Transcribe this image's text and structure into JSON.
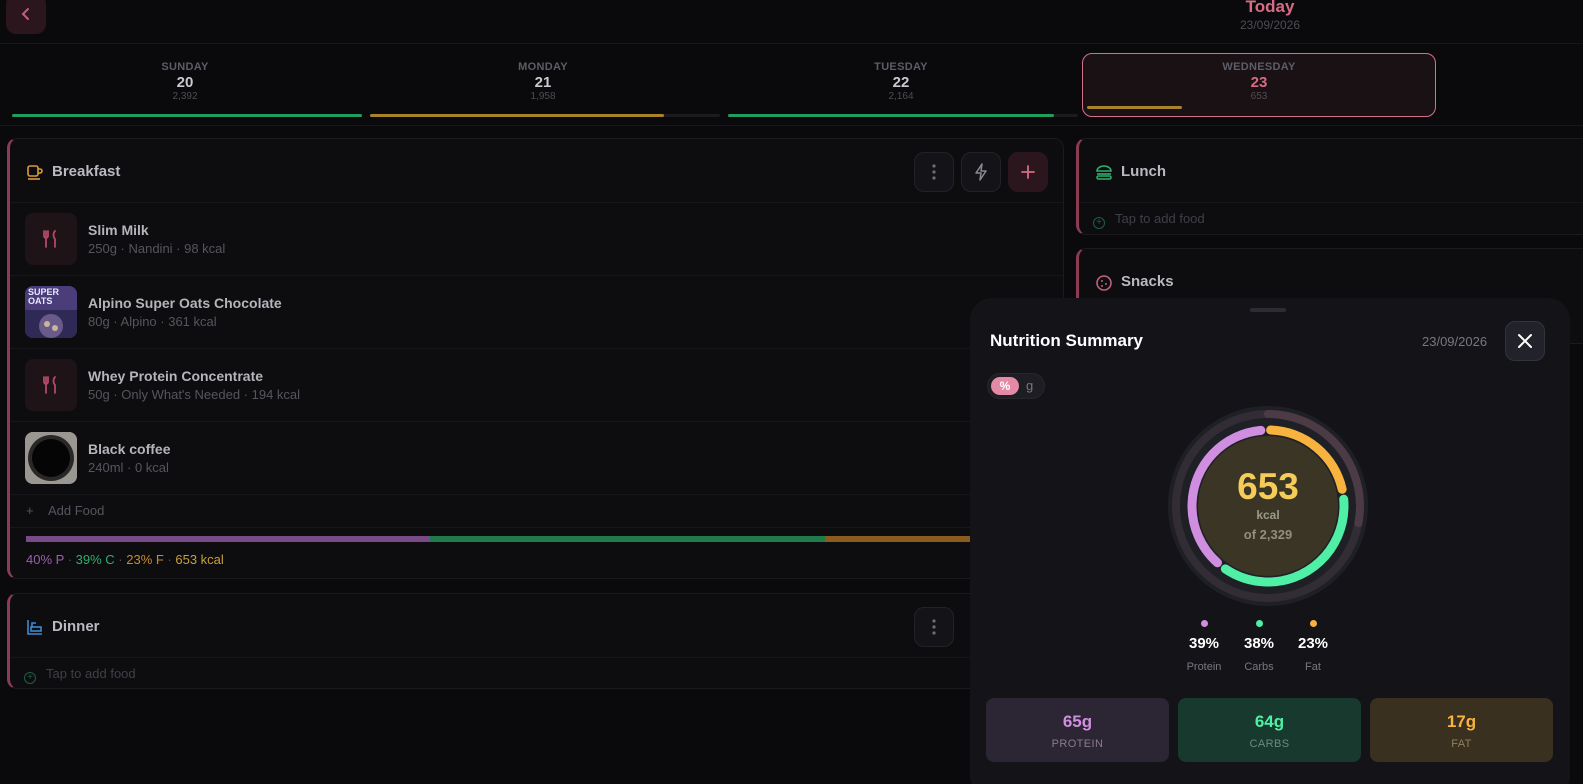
{
  "header": {
    "title": "Today",
    "date": "23/09/2026"
  },
  "days": [
    {
      "name": "SUNDAY",
      "num": "20",
      "kcal": "2,392",
      "progress": 1.0,
      "color": "#1f9e5e"
    },
    {
      "name": "MONDAY",
      "num": "21",
      "kcal": "1,958",
      "progress": 0.84,
      "color": "#a8832a"
    },
    {
      "name": "TUESDAY",
      "num": "22",
      "kcal": "2,164",
      "progress": 0.93,
      "color": "#1f9e5e"
    },
    {
      "name": "WEDNESDAY",
      "num": "23",
      "kcal": "653",
      "progress": 0.28,
      "color": "#a8832a"
    }
  ],
  "breakfast": {
    "title": "Breakfast",
    "foods": [
      {
        "name": "Slim Milk",
        "meta": "250g · Nandini · 98 kcal"
      },
      {
        "name": "Alpino Super Oats Chocolate",
        "meta": "80g · Alpino · 361 kcal"
      },
      {
        "name": "Whey Protein Concentrate",
        "meta": "50g · Only What's Needed · 194 kcal"
      },
      {
        "name": "Black coffee",
        "meta": "240ml · 0 kcal"
      }
    ],
    "add_food": "Add Food",
    "oats_thumb_text": "SUPER OATS",
    "macro_text": {
      "p": "40% P",
      "c": "39% C",
      "f": "23% F",
      "kcal": "653 kcal",
      "sep": " · "
    },
    "macro_split": {
      "p": 40,
      "c": 39,
      "f": 23
    }
  },
  "lunch": {
    "title": "Lunch",
    "tap": "Tap to add food"
  },
  "snacks": {
    "title": "Snacks"
  },
  "dinner": {
    "title": "Dinner",
    "tap": "Tap to add food"
  },
  "summary": {
    "title": "Nutrition Summary",
    "date": "23/09/2026",
    "toggle_pct": "%",
    "toggle_g": "g",
    "kcal": "653",
    "kcal_unit": "kcal",
    "kcal_of": "of 2,329",
    "kcal_progress": 0.28,
    "legend": [
      {
        "pct": "39%",
        "name": "Protein",
        "color": "#d08ee0"
      },
      {
        "pct": "38%",
        "name": "Carbs",
        "color": "#4ff0a6"
      },
      {
        "pct": "23%",
        "name": "Fat",
        "color": "#f7b33e"
      }
    ],
    "tiles": [
      {
        "value": "65g",
        "label": "PROTEIN",
        "bg": "#2c2533",
        "fg": "#d08ee0",
        "lfg": "#8a7a91"
      },
      {
        "value": "64g",
        "label": "CARBS",
        "bg": "#183a2e",
        "fg": "#4ff0a6",
        "lfg": "#6a8c7d"
      },
      {
        "value": "17g",
        "label": "FAT",
        "bg": "#3a3020",
        "fg": "#f7b33e",
        "lfg": "#8f8062"
      }
    ]
  }
}
